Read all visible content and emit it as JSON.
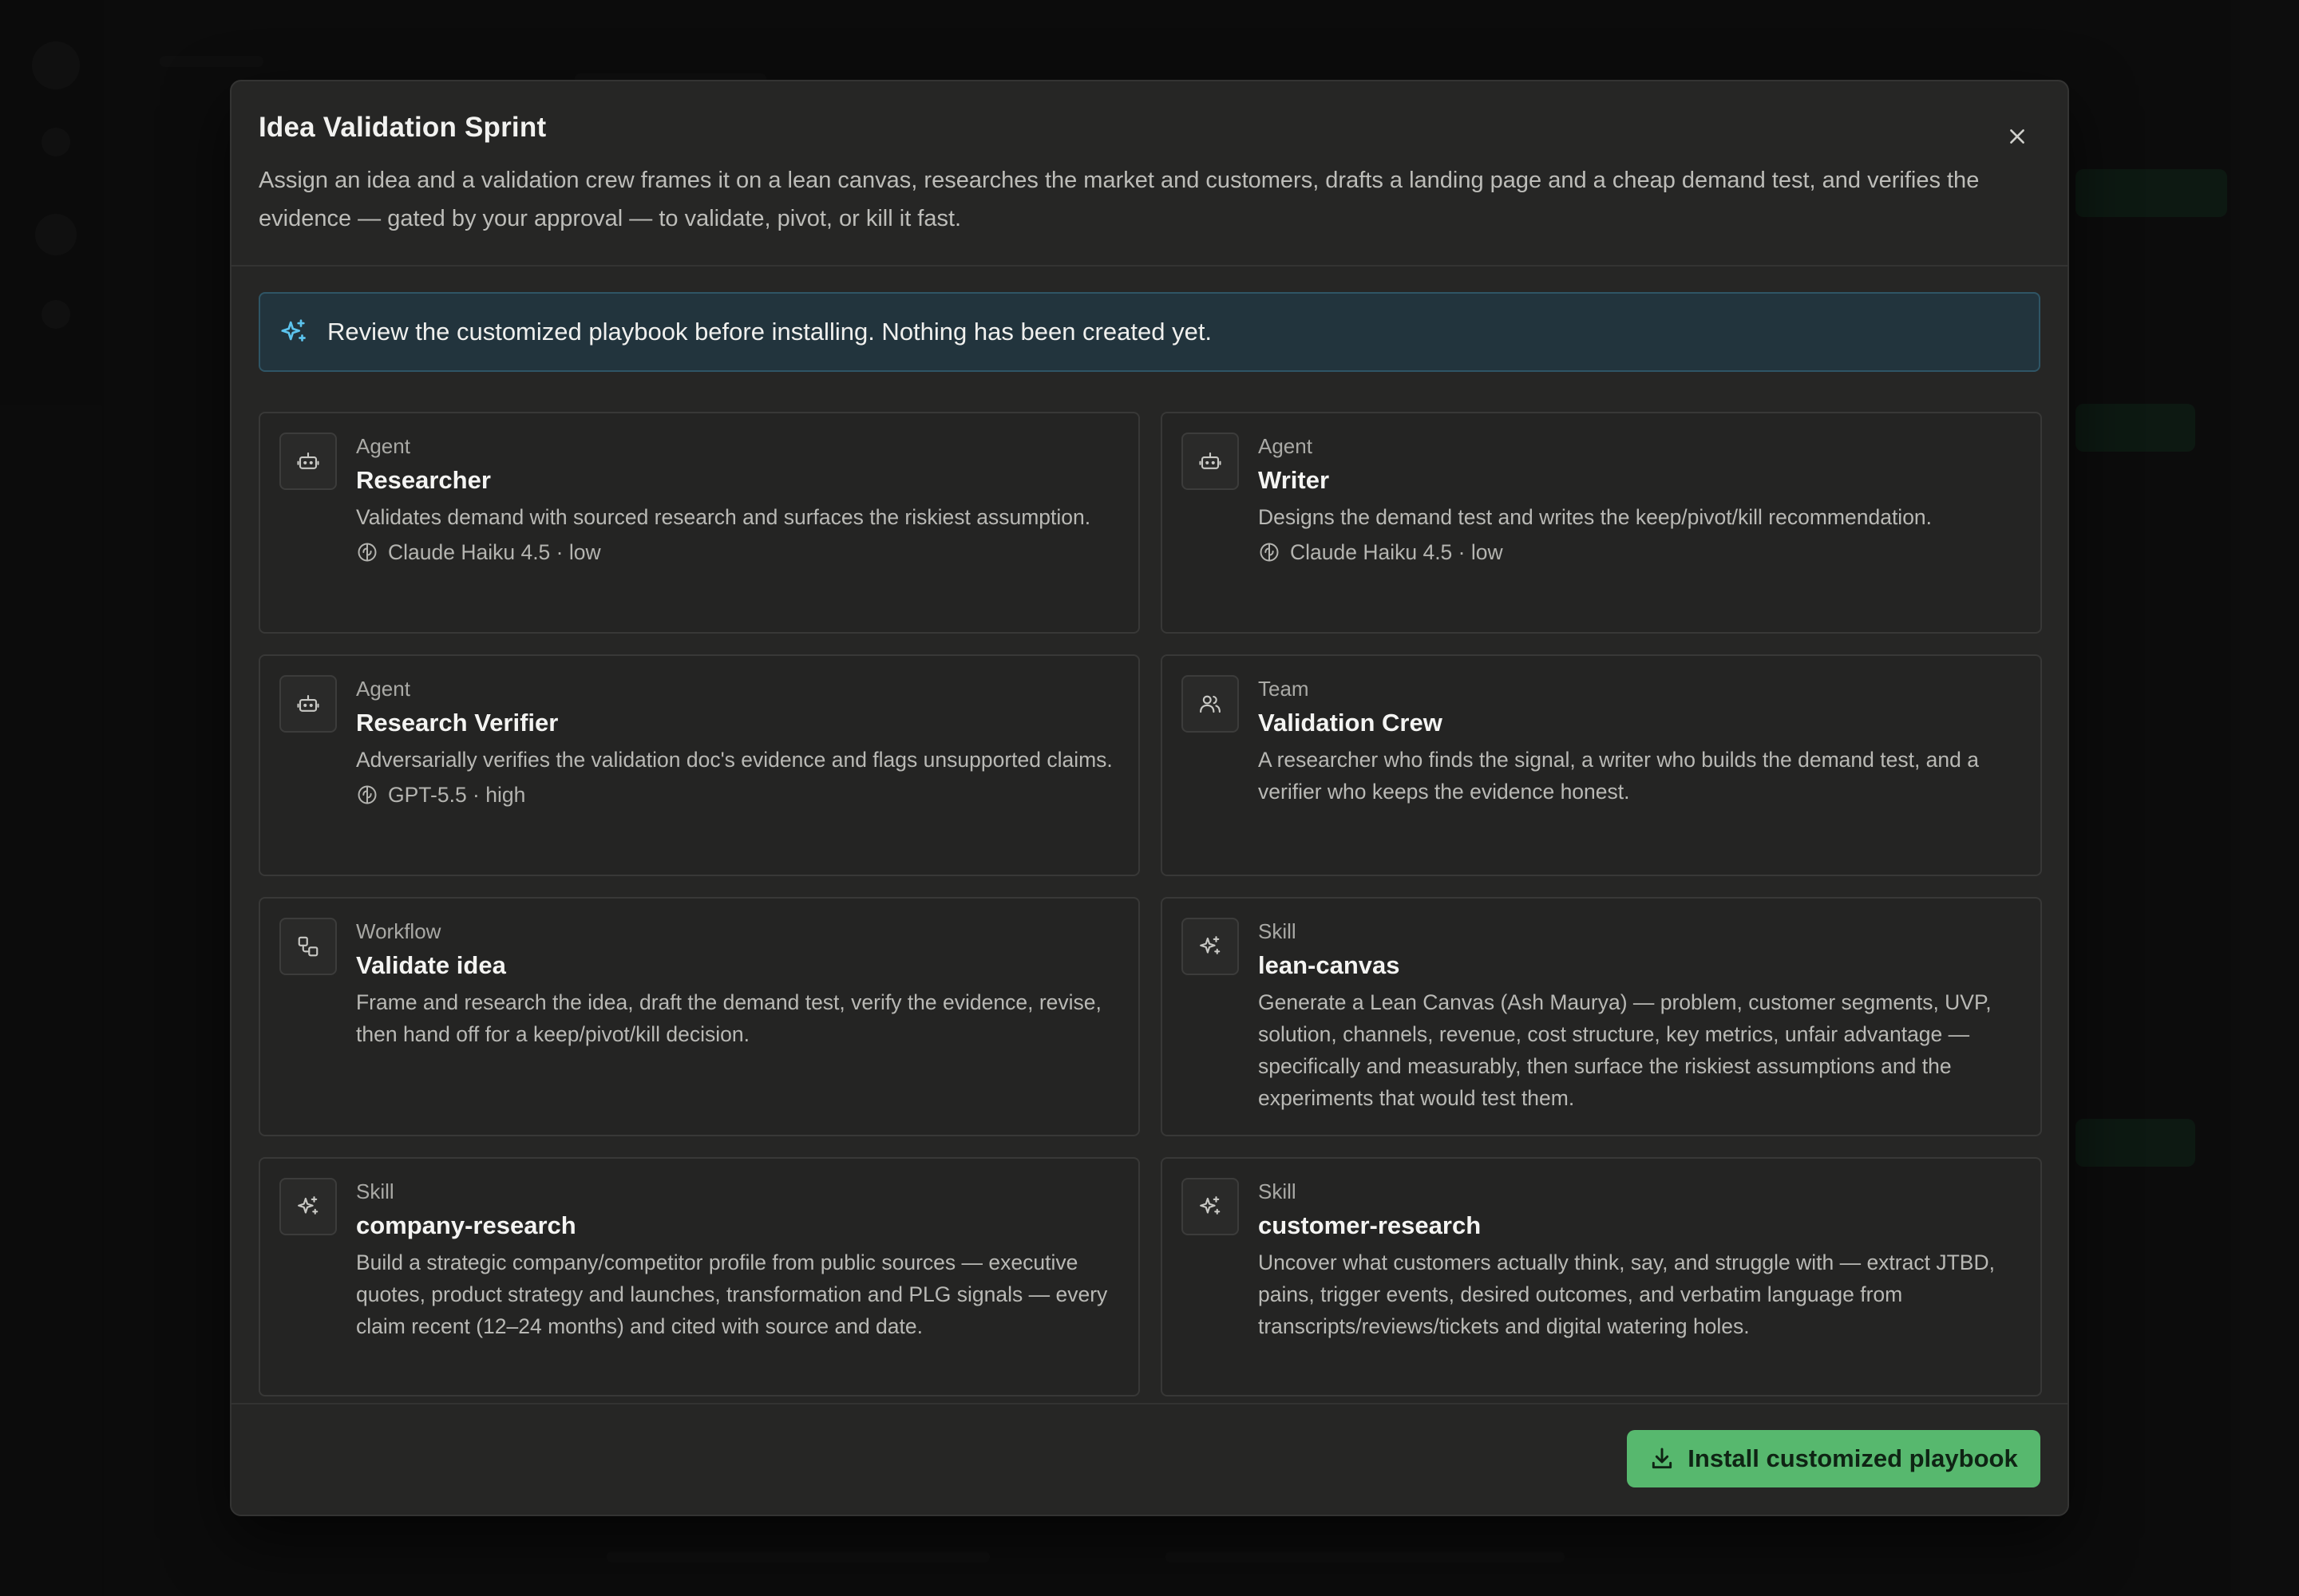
{
  "modal": {
    "title": "Idea Validation Sprint",
    "description": "Assign an idea and a validation crew frames it on a lean canvas, researches the market and customers, drafts a landing page and a cheap demand test, and verifies the evidence — gated by your approval — to validate, pivot, or kill it fast.",
    "close_icon": "close-icon"
  },
  "notice": {
    "icon": "sparkle-icon",
    "text": "Review the customized playbook before installing. Nothing has been created yet."
  },
  "cards": [
    {
      "kind": "Agent",
      "icon": "robot-icon",
      "name": "Researcher",
      "description": "Validates demand with sourced research and surfaces the riskiest assumption.",
      "model": "Claude Haiku 4.5 · low"
    },
    {
      "kind": "Agent",
      "icon": "robot-icon",
      "name": "Writer",
      "description": "Designs the demand test and writes the keep/pivot/kill recommendation.",
      "model": "Claude Haiku 4.5 · low"
    },
    {
      "kind": "Agent",
      "icon": "robot-icon",
      "name": "Research Verifier",
      "description": "Adversarially verifies the validation doc's evidence and flags unsupported claims.",
      "model": "GPT-5.5 · high"
    },
    {
      "kind": "Team",
      "icon": "users-icon",
      "name": "Validation Crew",
      "description": "A researcher who finds the signal, a writer who builds the demand test, and a verifier who keeps the evidence honest."
    },
    {
      "kind": "Workflow",
      "icon": "workflow-icon",
      "name": "Validate idea",
      "description": "Frame and research the idea, draft the demand test, verify the evidence, revise, then hand off for a keep/pivot/kill decision."
    },
    {
      "kind": "Skill",
      "icon": "sparkle-icon",
      "name": "lean-canvas",
      "description": "Generate a Lean Canvas (Ash Maurya) — problem, customer segments, UVP, solution, channels, revenue, cost structure, key metrics, unfair advantage — specifically and measurably, then surface the riskiest assumptions and the experiments that would test them."
    },
    {
      "kind": "Skill",
      "icon": "sparkle-icon",
      "name": "company-research",
      "description": "Build a strategic company/competitor profile from public sources — executive quotes, product strategy and launches, transformation and PLG signals — every claim recent (12–24 months) and cited with source and date."
    },
    {
      "kind": "Skill",
      "icon": "sparkle-icon",
      "name": "customer-research",
      "description": "Uncover what customers actually think, say, and struggle with — extract JTBD, pains, trigger events, desired outcomes, and verbatim language from transcripts/reviews/tickets and digital watering holes."
    }
  ],
  "footer": {
    "install_label": "Install customized playbook",
    "install_icon": "download-icon"
  },
  "colors": {
    "accent": "#57b86e",
    "notice_bg": "#22343d",
    "modal_bg": "#262625"
  }
}
